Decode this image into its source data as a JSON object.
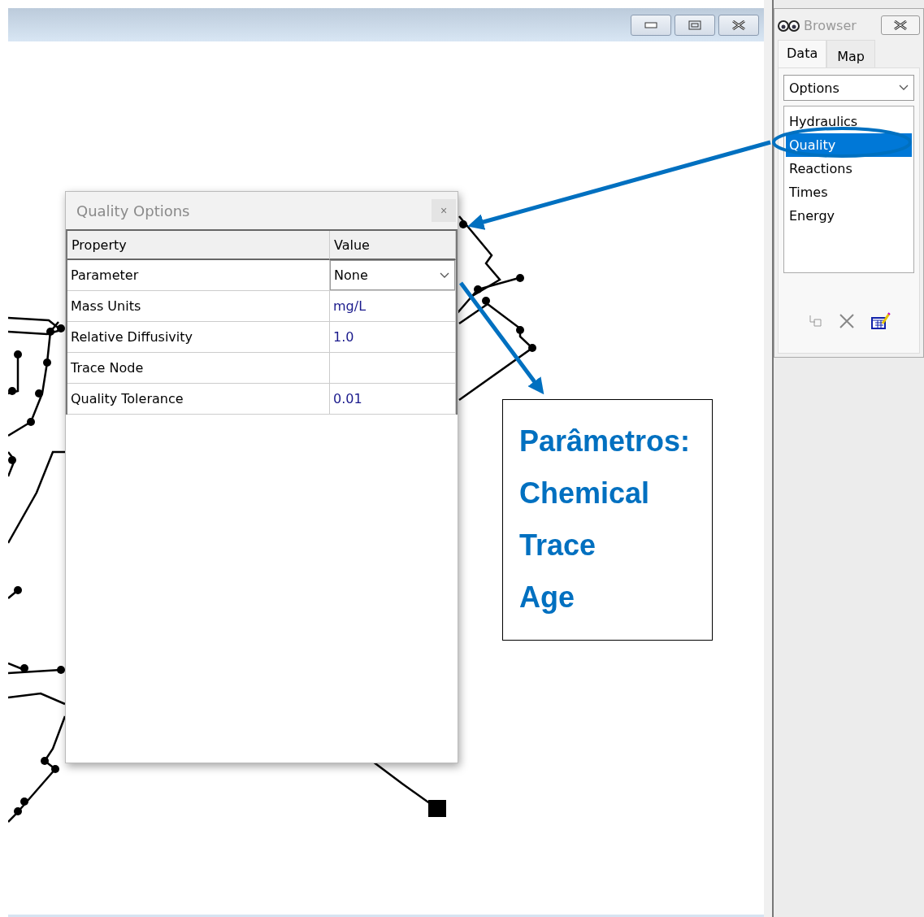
{
  "browser": {
    "title": "Browser",
    "tabs": [
      {
        "label": "Data",
        "selected": true
      },
      {
        "label": "Map",
        "selected": false
      }
    ],
    "category": {
      "value": "Options"
    },
    "items": [
      {
        "label": "Hydraulics",
        "selected": false
      },
      {
        "label": "Quality",
        "selected": true
      },
      {
        "label": "Reactions",
        "selected": false
      },
      {
        "label": "Times",
        "selected": false
      },
      {
        "label": "Energy",
        "selected": false
      }
    ]
  },
  "dialog": {
    "title": "Quality Options",
    "close": "×",
    "columns": [
      "Property",
      "Value"
    ],
    "rows": [
      {
        "property": "Parameter",
        "value": "None",
        "kind": "dropdown"
      },
      {
        "property": "Mass Units",
        "value": "mg/L",
        "kind": "text"
      },
      {
        "property": "Relative Diffusivity",
        "value": "1.0",
        "kind": "text"
      },
      {
        "property": "Trace Node",
        "kind": "text"
      },
      {
        "property": "Quality Tolerance",
        "value": "0.01",
        "kind": "text"
      }
    ]
  },
  "annotation": {
    "lines": [
      "Parâmetros:",
      "Chemical",
      "Trace",
      "Age"
    ]
  }
}
